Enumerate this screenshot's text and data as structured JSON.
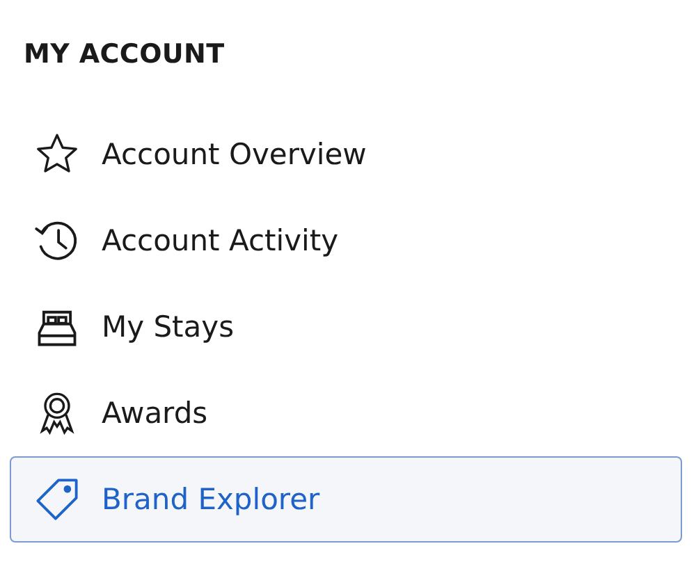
{
  "heading": "MY ACCOUNT",
  "items": [
    {
      "label": "Account Overview",
      "selected": false
    },
    {
      "label": "Account Activity",
      "selected": false
    },
    {
      "label": "My Stays",
      "selected": false
    },
    {
      "label": "Awards",
      "selected": false
    },
    {
      "label": "Brand Explorer",
      "selected": true
    }
  ]
}
